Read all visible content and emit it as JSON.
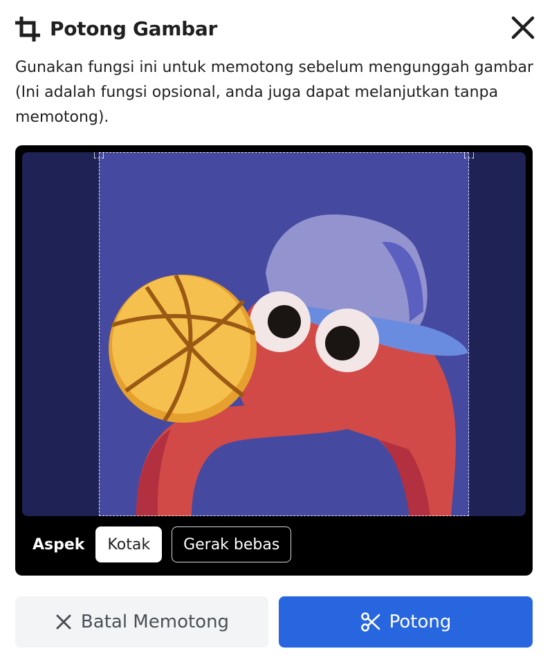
{
  "dialog": {
    "title": "Potong Gambar",
    "description": "Gunakan fungsi ini untuk memotong sebelum mengunggah gambar (Ini adalah fungsi opsional, anda juga dapat melanjutkan tanpa memotong).",
    "icons": {
      "title": "crop-icon",
      "close": "close-icon"
    }
  },
  "editor": {
    "aspect_label": "Aspek",
    "aspect_options": [
      {
        "label": "Kotak",
        "selected": true
      },
      {
        "label": "Gerak bebas",
        "selected": false
      }
    ]
  },
  "actions": {
    "cancel_label": "Batal Memotong",
    "cancel_icon": "close-icon",
    "crop_label": "Potong",
    "crop_icon": "scissors-icon"
  },
  "colors": {
    "primary": "#2866e0",
    "image_background": "#454aa0",
    "overlay": "#1e2255"
  }
}
